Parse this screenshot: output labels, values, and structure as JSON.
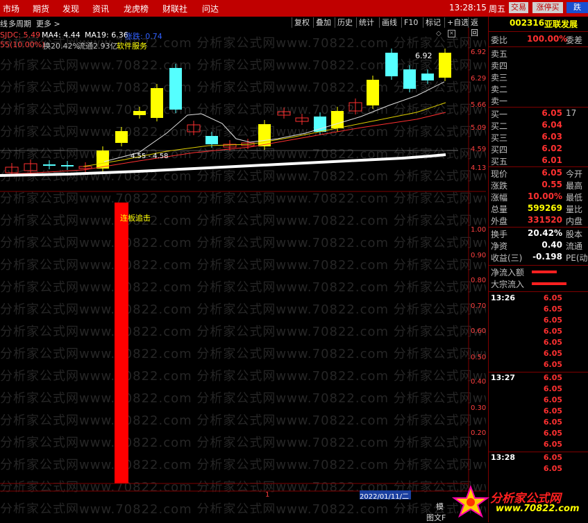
{
  "menubar": {
    "items": [
      "市场",
      "期货",
      "发现",
      "资讯",
      "龙虎榜",
      "财联社",
      "问达"
    ],
    "clock": "13:28:15",
    "weekday": "周五",
    "trade_btn": "交易",
    "limit_btn": "涨停买",
    "next_btn": "跌"
  },
  "toolbar": {
    "tabs": [
      "线",
      "多周期",
      "更多 >"
    ],
    "buttons": [
      "复权",
      "叠加",
      "历史",
      "统计",
      "画线",
      "F10",
      "标记",
      "+自选",
      "返回"
    ]
  },
  "info": {
    "indicator": "SJDC: 5.49",
    "ma4": "MA4: 4.44",
    "ma19": "MA19: 6.36",
    "extra": "涨跌: 0.74",
    "change": "55(10.00%)",
    "turnover": "换20.42%",
    "float_cap": "流通2.93亿",
    "sector": "软件服务"
  },
  "chart": {
    "annot_high": "6.92",
    "annot_ma": "4.55 - 4.58",
    "signal_label": "连板追击",
    "price_axis": [
      "6.92",
      "6.29",
      "5.66",
      "5.09",
      "4.59",
      "4.13"
    ],
    "ind_axis": [
      "1.00",
      "0.90",
      "0.80",
      "0.70",
      "0.60",
      "0.50",
      "0.40",
      "0.30",
      "0.20"
    ],
    "bottom_marker": "1",
    "bottom_date": "2022/01/11/二",
    "bottom_right": "模",
    "bottom_right2": "图文F"
  },
  "right_panel": {
    "code": "002316",
    "name": "亚联发展",
    "weibi_label": "委比",
    "weibi_value": "100.00%",
    "weicha_label": "委差",
    "sells": [
      "卖五",
      "卖四",
      "卖三",
      "卖二",
      "卖一"
    ],
    "buys": [
      {
        "label": "买一",
        "price": "6.05",
        "vol": "17"
      },
      {
        "label": "买二",
        "price": "6.04",
        "vol": ""
      },
      {
        "label": "买三",
        "price": "6.03",
        "vol": ""
      },
      {
        "label": "买四",
        "price": "6.02",
        "vol": ""
      },
      {
        "label": "买五",
        "price": "6.01",
        "vol": ""
      }
    ],
    "stats": [
      {
        "label": "现价",
        "value": "6.05",
        "color": "#ff3030",
        "extra": "今开"
      },
      {
        "label": "涨跌",
        "value": "0.55",
        "color": "#ff3030",
        "extra": "最高"
      },
      {
        "label": "涨幅",
        "value": "10.00%",
        "color": "#ff3030",
        "extra": "最低"
      },
      {
        "label": "总量",
        "value": "599269",
        "color": "#ffff00",
        "extra": "量比"
      },
      {
        "label": "外盘",
        "value": "331520",
        "color": "#ff3030",
        "extra": "内盘"
      }
    ],
    "stats2": [
      {
        "label": "换手",
        "value": "20.42%",
        "color": "#ffffff",
        "extra": "股本"
      },
      {
        "label": "净资",
        "value": "0.40",
        "color": "#ffffff",
        "extra": "流通"
      },
      {
        "label": "收益(三)",
        "value": "-0.198",
        "color": "#ffffff",
        "extra": "PE(动"
      }
    ],
    "flows": [
      {
        "label": "净流入额"
      },
      {
        "label": "大宗流入"
      }
    ],
    "ticks": [
      {
        "time": "13:26",
        "prices": [
          "6.05",
          "6.05",
          "6.05",
          "6.05",
          "6.05",
          "6.05",
          "6.05"
        ]
      },
      {
        "time": "13:27",
        "prices": [
          "6.05",
          "6.05",
          "6.05",
          "6.05",
          "6.05",
          "6.05",
          "6.05"
        ]
      },
      {
        "time": "13:28",
        "prices": [
          "6.05",
          "6.05"
        ]
      }
    ]
  },
  "watermark": {
    "text": "分析家公式网www.70822.com",
    "logo_text": "分析家公式网",
    "logo_url": "www.70822.com"
  },
  "colors": {
    "up": "#ff3030",
    "down": "#55ffff",
    "limit_up": "#ffff00",
    "panel_border": "#800000"
  }
}
